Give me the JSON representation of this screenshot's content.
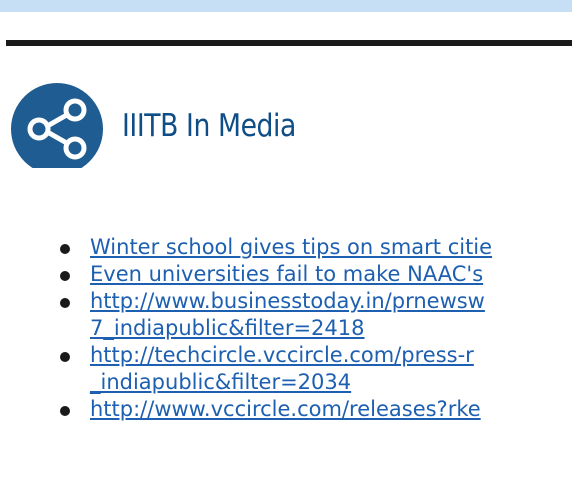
{
  "header": {
    "band_color": "#c7dff4",
    "divider_color": "#1a1a1a"
  },
  "section": {
    "icon": "share-icon",
    "icon_color": "#1f5c92",
    "title": "IIITB In Media",
    "title_color": "#0f4d86"
  },
  "media_links": [
    {
      "lines": [
        "Winter school gives tips on smart citie"
      ]
    },
    {
      "lines": [
        "Even universities fail to make NAAC's"
      ]
    },
    {
      "lines": [
        "http://www.businesstoday.in/prnewsw",
        "7_indiapublic&filter=2418"
      ]
    },
    {
      "lines": [
        "http://techcircle.vccircle.com/press-r",
        "_indiapublic&filter=2034"
      ]
    },
    {
      "lines": [
        "http://www.vccircle.com/releases?rke"
      ]
    }
  ],
  "link_color": "#1d5fb0"
}
